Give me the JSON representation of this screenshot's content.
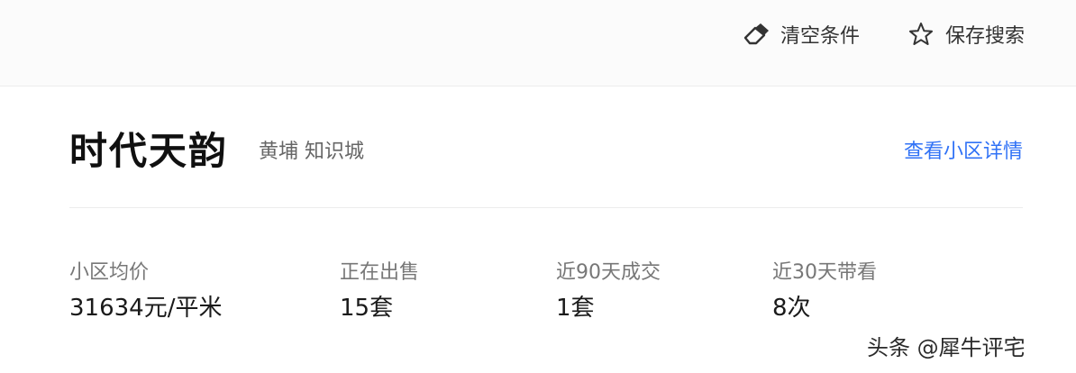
{
  "toolbar": {
    "clear_label": "清空条件",
    "save_label": "保存搜索",
    "clear_icon": "eraser-icon",
    "save_icon": "star-outline-icon"
  },
  "community": {
    "name": "时代天韵",
    "location": "黄埔 知识城",
    "detail_link": "查看小区详情"
  },
  "stats": [
    {
      "label": "小区均价",
      "value": "31634元/平米"
    },
    {
      "label": "正在出售",
      "value": "15套"
    },
    {
      "label": "近90天成交",
      "value": "1套"
    },
    {
      "label": "近30天带看",
      "value": "8次"
    }
  ],
  "watermark": "头条 @犀牛评宅",
  "colors": {
    "link": "#3072f6",
    "title": "#101010",
    "label": "#777777"
  }
}
